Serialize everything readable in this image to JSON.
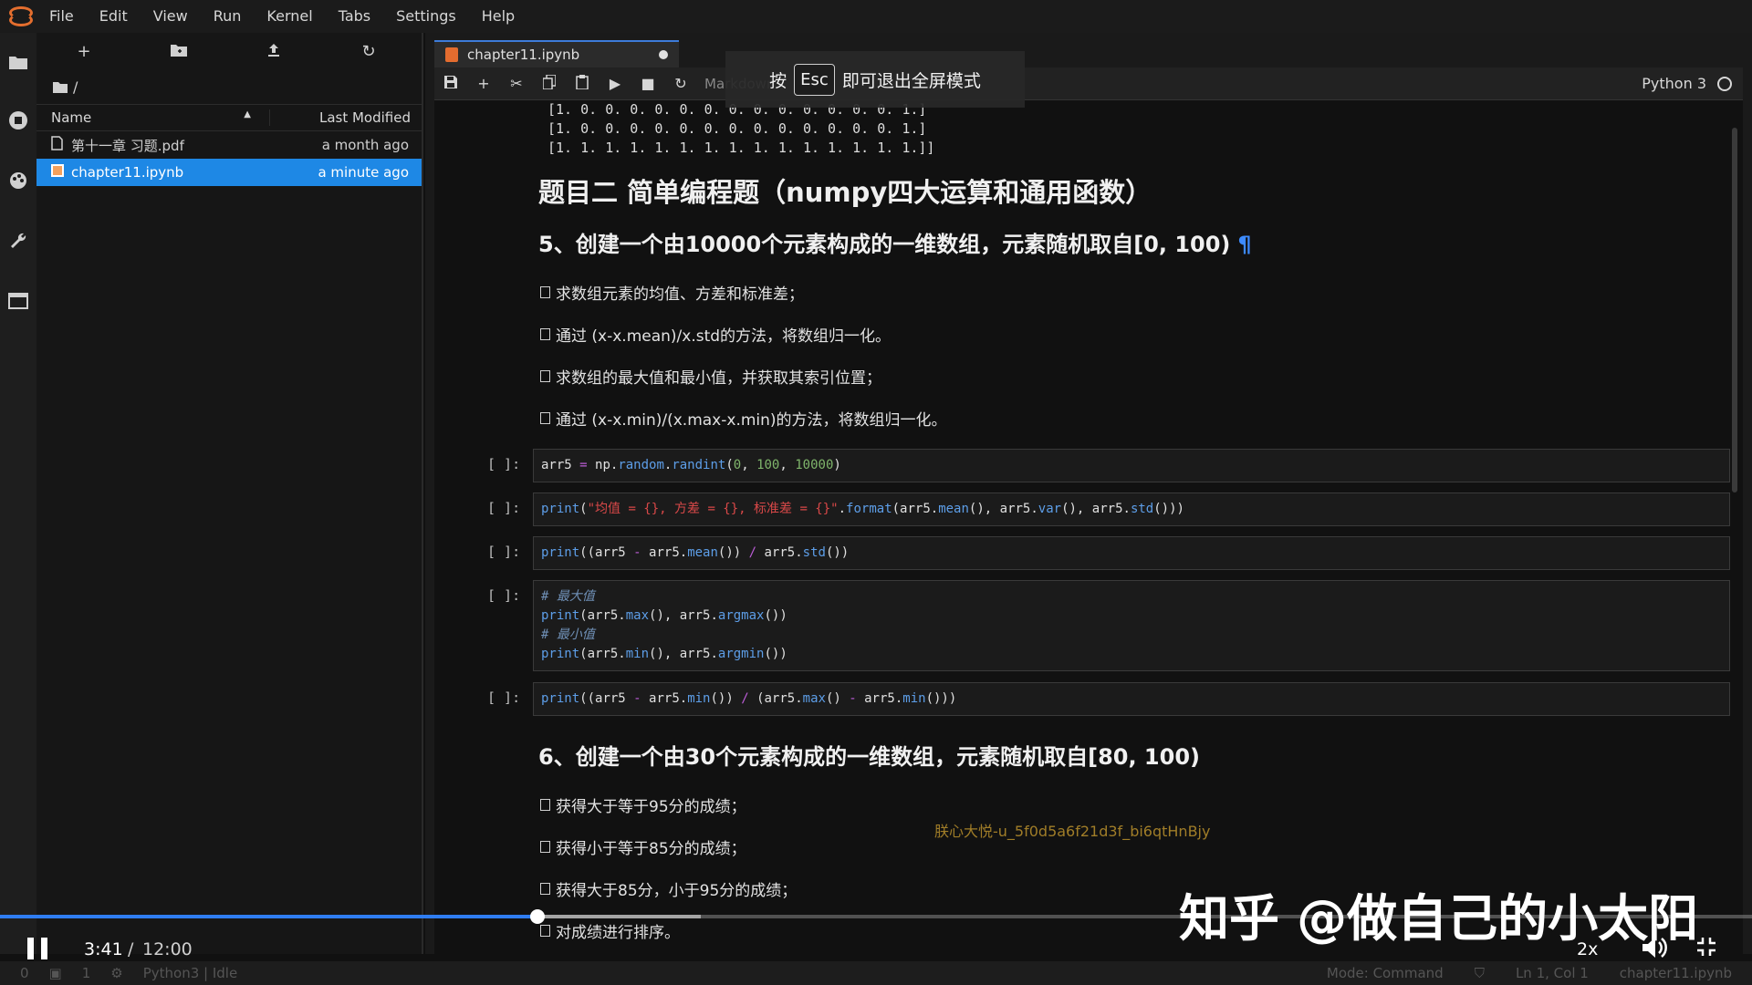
{
  "menu": [
    "File",
    "Edit",
    "View",
    "Run",
    "Kernel",
    "Tabs",
    "Settings",
    "Help"
  ],
  "filebrowser": {
    "path": "/",
    "columns": {
      "name": "Name",
      "modified": "Last Modified"
    },
    "files": [
      {
        "name": "第十一章 习题.pdf",
        "modified": "a month ago",
        "icon": "pdf-file-icon",
        "selected": false
      },
      {
        "name": "chapter11.ipynb",
        "modified": "a minute ago",
        "icon": "notebook-icon",
        "selected": true
      }
    ]
  },
  "notebook": {
    "tab_title": "chapter11.ipynb",
    "cell_type": "Markdown",
    "kernel": "Python 3",
    "output_lines": [
      "[1. 0. 0. 0. 0. 0. 0. 0. 0. 0. 0. 0. 0. 0. 1.]",
      "[1. 0. 0. 0. 0. 0. 0. 0. 0. 0. 0. 0. 0. 0. 1.]",
      "[1. 1. 1. 1. 1. 1. 1. 1. 1. 1. 1. 1. 1. 1. 1.]]"
    ],
    "heading_2": "题目二 简单编程题（numpy四大运算和通用函数）",
    "q5_title": "5、创建一个由10000个元素构成的一维数组，元素随机取自[0, 100)",
    "q5_items": [
      "求数组元素的均值、方差和标准差；",
      "通过 (x-x.mean)/x.std的方法，将数组归一化。",
      "求数组的最大值和最小值，并获取其索引位置；",
      "通过 (x-x.min)/(x.max-x.min)的方法，将数组归一化。"
    ],
    "prompt": "[ ]:",
    "q6_title": "6、创建一个由30个元素构成的一维数组，元素随机取自[80, 100)",
    "q6_items": [
      "获得大于等于95分的成绩；",
      "获得小于等于85分的成绩；",
      "获得大于85分，小于95分的成绩；",
      "对成绩进行排序。"
    ],
    "watermark": "朕心大悦-u_5f0d5a6f21d3f_bi6qtHnBjy"
  },
  "toast": {
    "before": "按",
    "key": "Esc",
    "after": "即可退出全屏模式"
  },
  "statusbar": {
    "left": [
      "0",
      "1",
      "Python3 | Idle"
    ],
    "right": [
      "Mode: Command",
      "Ln 1, Col 1",
      "chapter11.ipynb"
    ]
  },
  "player": {
    "current_time": "3:41",
    "separator": "/",
    "total_time": "12:00",
    "progress_fraction": 0.307,
    "buffer_fraction": 0.4,
    "speed": "2x",
    "brand": "知乎 @做自己的小太阳"
  },
  "colors": {
    "accent": "#1e88e5",
    "progress": "#2f7df2"
  }
}
